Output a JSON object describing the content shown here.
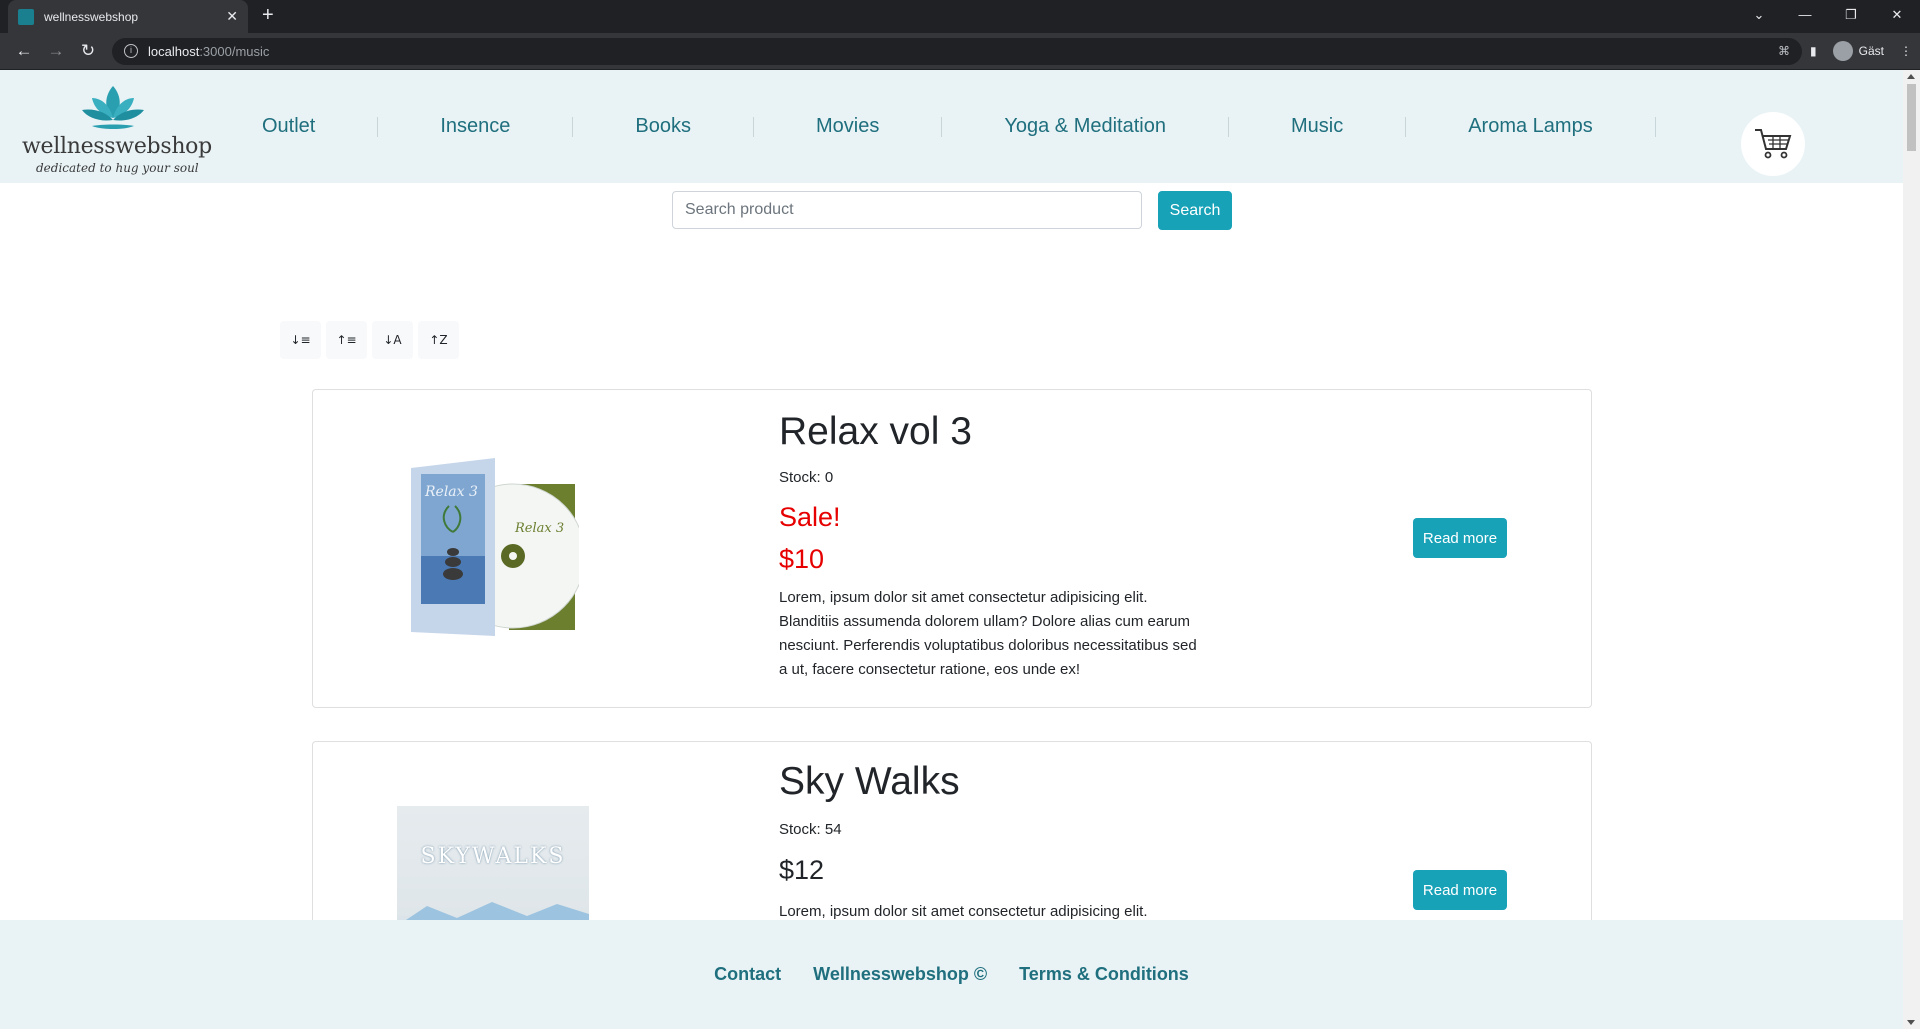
{
  "browser": {
    "tab_title": "wellnesswebshop",
    "url_host": "localhost",
    "url_path": ":3000/music",
    "profile_label": "Gäst"
  },
  "header": {
    "logo_name": "wellnesswebshop",
    "logo_tagline": "dedicated to hug your soul",
    "nav": [
      "Outlet",
      "Insence",
      "Books",
      "Movies",
      "Yoga & Meditation",
      "Music",
      "Aroma Lamps"
    ]
  },
  "search": {
    "placeholder": "Search product",
    "button_label": "Search"
  },
  "sort_buttons": [
    {
      "icon": "sort-desc-icon",
      "glyph": "↓≡"
    },
    {
      "icon": "sort-asc-icon",
      "glyph": "↑≡"
    },
    {
      "icon": "sort-alpha-asc-icon",
      "glyph": "↓A"
    },
    {
      "icon": "sort-alpha-desc-icon",
      "glyph": "↑Z"
    }
  ],
  "products": [
    {
      "title": "Relax vol 3",
      "stock": "Stock: 0",
      "sale": "Sale!",
      "price": "$10",
      "description": "Lorem, ipsum dolor sit amet consectetur adipisicing elit. Blanditiis assumenda dolorem ullam? Dolore alias cum earum nesciunt. Perferendis voluptatibus doloribus necessitatibus sed a ut, facere consectetur ratione, eos unde ex!",
      "cover_text_1": "Relax 3",
      "cover_text_2": "Relax 3",
      "button": "Read more"
    },
    {
      "title": "Sky Walks",
      "stock": "Stock: 54",
      "price": "$12",
      "description": "Lorem, ipsum dolor sit amet consectetur adipisicing elit. Blanditiis",
      "cover_text": "SKYWALKS",
      "button": "Read more"
    }
  ],
  "footer": {
    "links": [
      "Contact",
      "Wellnesswebshop ©",
      "Terms & Conditions"
    ]
  },
  "colors": {
    "brand_teal": "#17a2b8",
    "nav_text": "#1f6f7e",
    "header_bg": "#e9f3f5",
    "sale_red": "#e60000"
  }
}
